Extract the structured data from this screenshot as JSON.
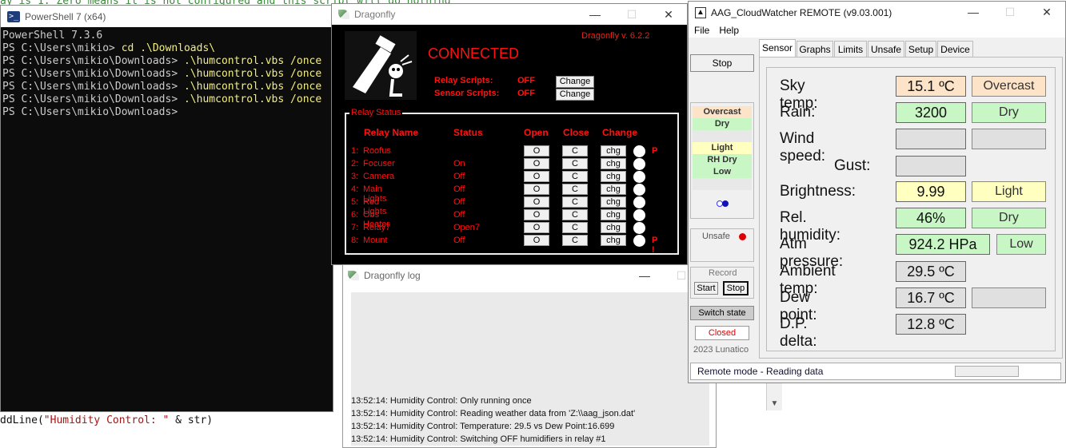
{
  "background_editor": {
    "top_line": "ay is 1. Zero means it is not configured and this script will do nothing",
    "bottom_prefix": "ddLine(",
    "bottom_string": "\"Humidity Control: \"",
    "bottom_suffix": " & str)"
  },
  "powershell": {
    "title": "PowerShell 7 (x64)",
    "icon": "terminal-icon",
    "lines": [
      {
        "text": "PowerShell 7.3.6",
        "cmd": ""
      },
      {
        "text": "PS C:\\Users\\mikio> ",
        "cmd": "cd .\\Downloads\\"
      },
      {
        "text": "PS C:\\Users\\mikio\\Downloads> ",
        "cmd": ".\\humcontrol.vbs /once"
      },
      {
        "text": "PS C:\\Users\\mikio\\Downloads> ",
        "cmd": ".\\humcontrol.vbs /once"
      },
      {
        "text": "PS C:\\Users\\mikio\\Downloads> ",
        "cmd": ".\\humcontrol.vbs /once"
      },
      {
        "text": "PS C:\\Users\\mikio\\Downloads> ",
        "cmd": ".\\humcontrol.vbs /once"
      },
      {
        "text": "PS C:\\Users\\mikio\\Downloads> ",
        "cmd": ""
      }
    ]
  },
  "dragonfly": {
    "title": "Dragonfly",
    "version": "Dragonfly v. 6.2.2",
    "connection": "CONNECTED",
    "relay_scripts_label": "Relay Scripts:",
    "relay_scripts_value": "OFF",
    "sensor_scripts_label": "Sensor Scripts:",
    "sensor_scripts_value": "OFF",
    "change_label": "Change",
    "relay_status_label": "Relay Status",
    "headers": {
      "name": "Relay Name",
      "status": "Status",
      "open": "Open",
      "close": "Close",
      "change": "Change"
    },
    "open_btn": "O",
    "close_btn": "C",
    "chg_btn": "chg",
    "relays": [
      {
        "num": "1:",
        "name": "Roofus",
        "status": "",
        "mark": "P"
      },
      {
        "num": "2:",
        "name": "Focuser",
        "status": "On",
        "mark": ""
      },
      {
        "num": "3:",
        "name": "Camera",
        "status": "Off",
        "mark": ""
      },
      {
        "num": "4:",
        "name": "Main Lights",
        "status": "Off",
        "mark": ""
      },
      {
        "num": "5:",
        "name": "Red Lights",
        "status": "Off",
        "mark": ""
      },
      {
        "num": "6:",
        "name": "Obs Heater",
        "status": "Off",
        "mark": ""
      },
      {
        "num": "7:",
        "name": "Relay7",
        "status": "Open7",
        "mark": ""
      },
      {
        "num": "8:",
        "name": "Mount",
        "status": "Off",
        "mark": "P !"
      }
    ],
    "win_controls": {
      "minimize": "—",
      "maximize": "☐",
      "close": "✕"
    }
  },
  "dragonfly_log": {
    "title": "Dragonfly log",
    "lines": [
      "13:52:14: Humidity Control: Only running once",
      "13:52:14: Humidity Control: Reading weather data from 'Z:\\\\aag_json.dat'",
      "13:52:14: Humidity Control: Temperature: 29.5 vs Dew Point:16.699",
      "13:52:14: Humidity Control: Switching OFF humidifiers in relay #1"
    ]
  },
  "cloudwatcher": {
    "title": "AAG_CloudWatcher REMOTE (v9.03.001)",
    "menu": [
      "File",
      "Help"
    ],
    "stop_label": "Stop",
    "summary": [
      {
        "text": "Overcast",
        "bg": "#fde3c8"
      },
      {
        "text": "Dry",
        "bg": "#c8f7c5"
      },
      {
        "text": "",
        "bg": "#e8e8e8"
      },
      {
        "text": "Light",
        "bg": "#ffffc0"
      },
      {
        "text": "RH Dry",
        "bg": "#c8f7c5"
      },
      {
        "text": "Low",
        "bg": "#c8f7c5"
      },
      {
        "text": "",
        "bg": "#e8e8e8"
      }
    ],
    "unsafe_label": "Unsafe",
    "record_label": "Record",
    "record_start": "Start",
    "record_stop": "Stop",
    "switch_state_label": "Switch state",
    "closed_label": "Closed",
    "copyright": "2023 Lunatico",
    "tabs": [
      "Sensor",
      "Graphs",
      "Limits",
      "Unsafe",
      "Setup",
      "Device"
    ],
    "readings": [
      {
        "label": "Sky temp:",
        "value": "15.1 ºC",
        "value_bg": "#fde3c8",
        "status": "Overcast",
        "status_bg": "#fde3c8"
      },
      {
        "label": "Rain:",
        "value": "3200",
        "value_bg": "#c8f7c5",
        "status": "Dry",
        "status_bg": "#c8f7c5"
      },
      {
        "label": "Wind speed:",
        "value": "",
        "value_bg": "#e0e0e0",
        "status": "",
        "status_bg": "#e0e0e0"
      },
      {
        "label": "Gust:",
        "value": "",
        "value_bg": "#e0e0e0",
        "status": null,
        "status_bg": ""
      },
      {
        "label": "Brightness:",
        "value": "9.99",
        "value_bg": "#ffffc0",
        "status": "Light",
        "status_bg": "#ffffc0"
      },
      {
        "label": "Rel. humidity:",
        "value": "46%",
        "value_bg": "#c8f7c5",
        "status": "Dry",
        "status_bg": "#c8f7c5"
      },
      {
        "label": "Atm pressure:",
        "value": "924.2 HPa",
        "value_bg": "#c8f7c5",
        "status": "Low",
        "status_bg": "#c8f7c5"
      },
      {
        "label": "Ambient temp:",
        "value": "29.5 ºC",
        "value_bg": "#e0e0e0",
        "status": null,
        "status_bg": ""
      },
      {
        "label": "Dew point:",
        "value": "16.7 ºC",
        "value_bg": "#e0e0e0",
        "status": "",
        "status_bg": "#e0e0e0"
      },
      {
        "label": "D.P. delta:",
        "value": "12.8 ºC",
        "value_bg": "#e0e0e0",
        "status": null,
        "status_bg": ""
      }
    ],
    "status_bar": "Remote mode - Reading data",
    "win_controls": {
      "minimize": "—",
      "maximize": "☐",
      "close": "✕"
    }
  }
}
